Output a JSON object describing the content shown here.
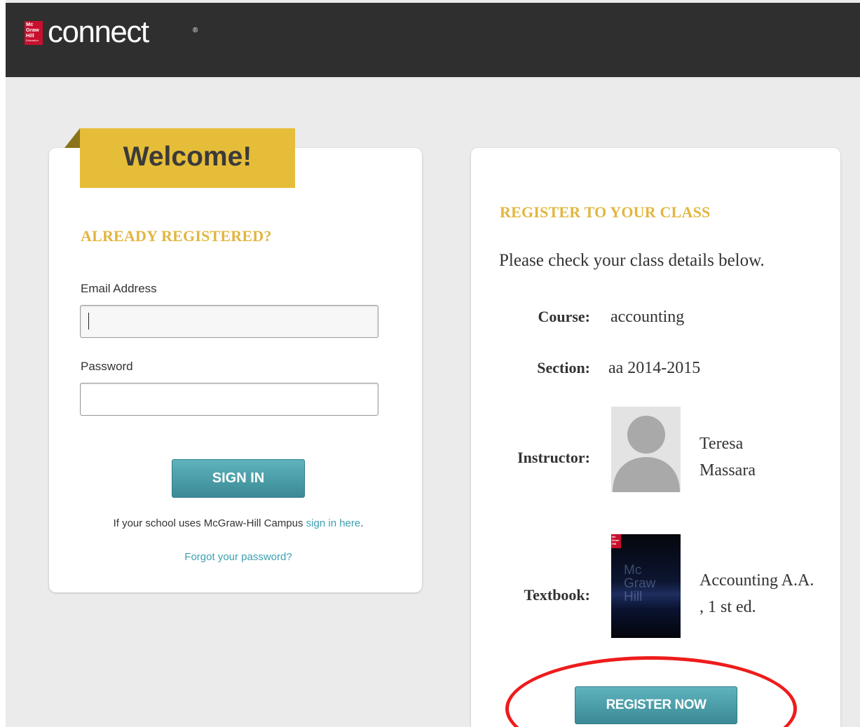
{
  "header": {
    "logo_badge": {
      "line1": "Mc",
      "line2": "Graw",
      "line3": "Hill",
      "line4": "Education"
    },
    "logo_text": "connect",
    "logo_mark": "®",
    "background_color": "#2f2f2f"
  },
  "login": {
    "ribbon_title": "Welcome!",
    "heading": "ALREADY REGISTERED?",
    "email_label": "Email Address",
    "email_value": "",
    "password_label": "Password",
    "password_value": "",
    "sign_in_label": "SIGN IN",
    "campus_text": "If your school uses McGraw-Hill Campus",
    "campus_link": "sign in here",
    "campus_suffix": ".",
    "forgot_link": "Forgot your password?"
  },
  "register": {
    "heading": "REGISTER TO YOUR CLASS",
    "intro": "Please check your class details below.",
    "course_label": "Course:",
    "course_value": "accounting",
    "section_label": "Section:",
    "section_value": "aa 2014-2015",
    "instructor_label": "Instructor:",
    "instructor_name": "Teresa Massara",
    "textbook_label": "Textbook:",
    "textbook_value": "Accounting A.A. , 1 st ed.",
    "textbook_cover": {
      "badge_line1": "Mc",
      "badge_line2": "Graw",
      "badge_line3": "Hill",
      "cover_line1": "Mc",
      "cover_line2": "Graw",
      "cover_line3": "Hill"
    },
    "register_button_label": "REGISTER NOW"
  },
  "colors": {
    "accent_gold": "#e2b640",
    "ribbon_gold": "#e6bd38",
    "button_teal": "#4a9ea8",
    "link_teal": "#3b9fb0",
    "highlight_red": "#ee1c1c"
  },
  "icons": {
    "instructor_avatar": "person-silhouette-icon"
  }
}
